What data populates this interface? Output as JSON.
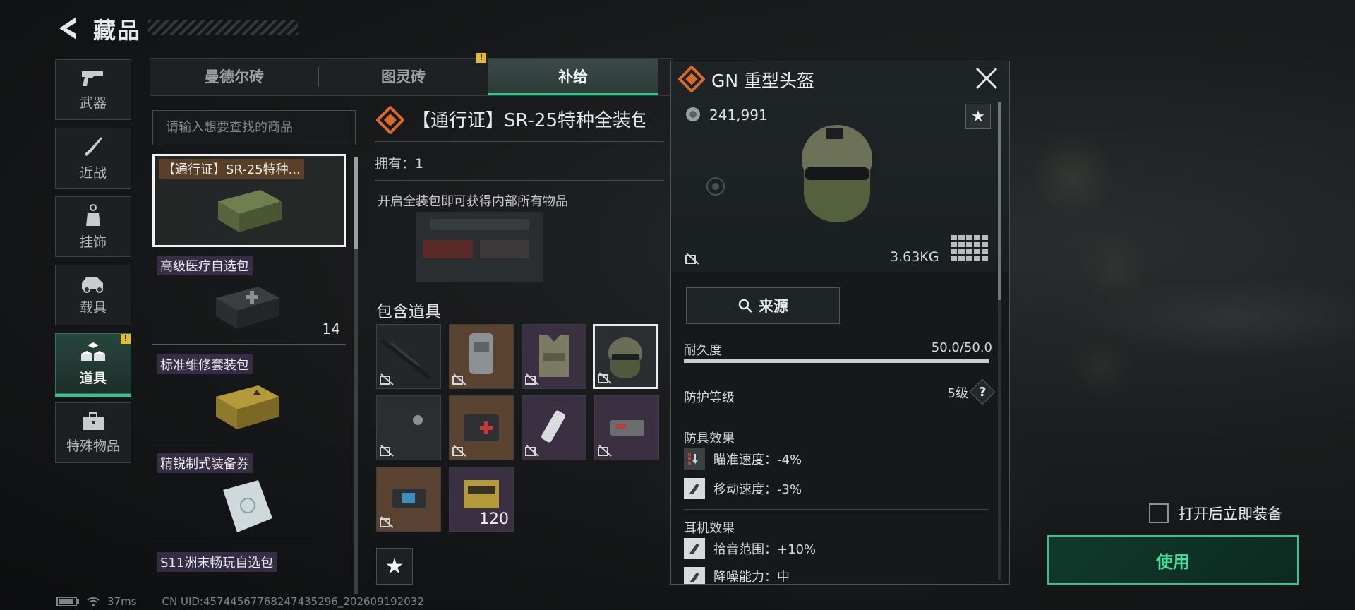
{
  "header": {
    "title": "藏品"
  },
  "sidebar": {
    "items": [
      {
        "label": "武器",
        "icon": "gun-icon"
      },
      {
        "label": "近战",
        "icon": "knife-icon"
      },
      {
        "label": "挂饰",
        "icon": "charm-icon"
      },
      {
        "label": "载具",
        "icon": "vehicle-icon"
      },
      {
        "label": "道具",
        "icon": "props-icon",
        "active": true,
        "alert": "!"
      },
      {
        "label": "特殊物品",
        "icon": "briefcase-icon"
      }
    ]
  },
  "tabs": [
    {
      "label": "曼德尔砖"
    },
    {
      "label": "图灵砖",
      "alert": "!"
    },
    {
      "label": "补给",
      "active": true
    }
  ],
  "search": {
    "placeholder": "请输入想要查找的商品"
  },
  "items": [
    {
      "name": "【通行证】SR-25特种...",
      "selected": true
    },
    {
      "name": "高级医疗自选包",
      "count": "14"
    },
    {
      "name": "标准维修套装包"
    },
    {
      "name": "精锐制式装备券"
    },
    {
      "name": "S11洲末畅玩自选包"
    }
  ],
  "detail": {
    "title": "【通行证】SR-25特种全装包",
    "owned": "拥有：1",
    "description": "开启全装包即可获得内部所有物品",
    "contains_label": "包含道具",
    "slots": [
      {
        "name": "rifle"
      },
      {
        "name": "backpack"
      },
      {
        "name": "vest"
      },
      {
        "name": "helmet",
        "selected": true
      },
      {
        "name": "headset"
      },
      {
        "name": "medkit"
      },
      {
        "name": "injector"
      },
      {
        "name": "repair-kit"
      },
      {
        "name": "armor-pack"
      },
      {
        "name": "ammo-box",
        "qty": "120"
      }
    ]
  },
  "popup": {
    "title": "GN 重型头盔",
    "price": "241,991",
    "weight": "3.63KG",
    "source_label": "来源",
    "durability_label": "耐久度",
    "durability_value": "50.0/50.0",
    "durability_fraction": 1.0,
    "protection_label": "防护等级",
    "protection_value": "5级",
    "help": "?",
    "armor_section": "防具效果",
    "armor_effects": [
      "瞄准速度：-4%",
      "移动速度：-3%"
    ],
    "headset_section": "耳机效果",
    "headset_effects": [
      "拾音范围：+10%",
      "降噪能力：中"
    ]
  },
  "equip_toggle": {
    "label": "打开后立即装备",
    "checked": false
  },
  "use_button": {
    "label": "使用"
  },
  "status": {
    "ping": "37ms",
    "uid": "CN UID:457445677682474352​96_202609192032"
  },
  "colors": {
    "accent": "#2fc88c",
    "warning": "#e8b92a",
    "brand": "#d96a2b"
  }
}
